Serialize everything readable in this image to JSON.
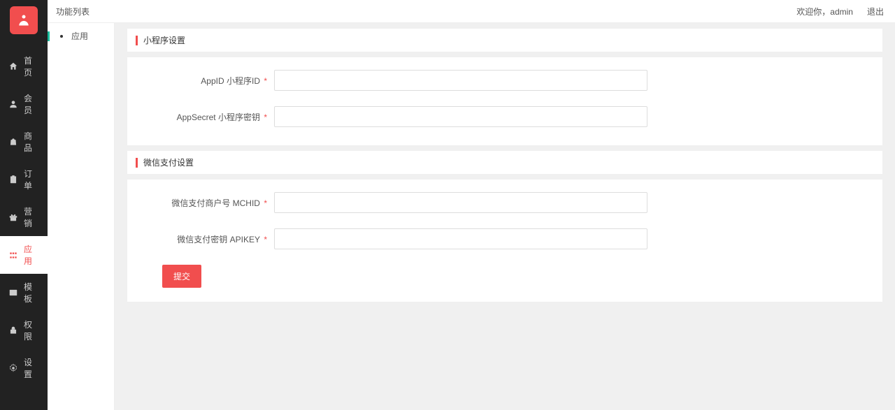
{
  "header": {
    "title": "功能列表",
    "welcome": "欢迎你，admin",
    "logout": "退出"
  },
  "sidebar": {
    "items": [
      {
        "label": "首页"
      },
      {
        "label": "会员"
      },
      {
        "label": "商品"
      },
      {
        "label": "订单"
      },
      {
        "label": "营销"
      },
      {
        "label": "应用"
      },
      {
        "label": "模板"
      },
      {
        "label": "权限"
      },
      {
        "label": "设置"
      }
    ]
  },
  "subnav": {
    "items": [
      {
        "label": "应用"
      }
    ]
  },
  "sections": {
    "miniprogram": {
      "title": "小程序设置",
      "fields": {
        "appid_label": "AppID 小程序ID",
        "appid_value": "",
        "appsecret_label": "AppSecret 小程序密钥",
        "appsecret_value": ""
      }
    },
    "wxpay": {
      "title": "微信支付设置",
      "fields": {
        "mchid_label": "微信支付商户号 MCHID",
        "mchid_value": "",
        "apikey_label": "微信支付密钥 APIKEY",
        "apikey_value": ""
      }
    }
  },
  "actions": {
    "submit": "提交"
  }
}
